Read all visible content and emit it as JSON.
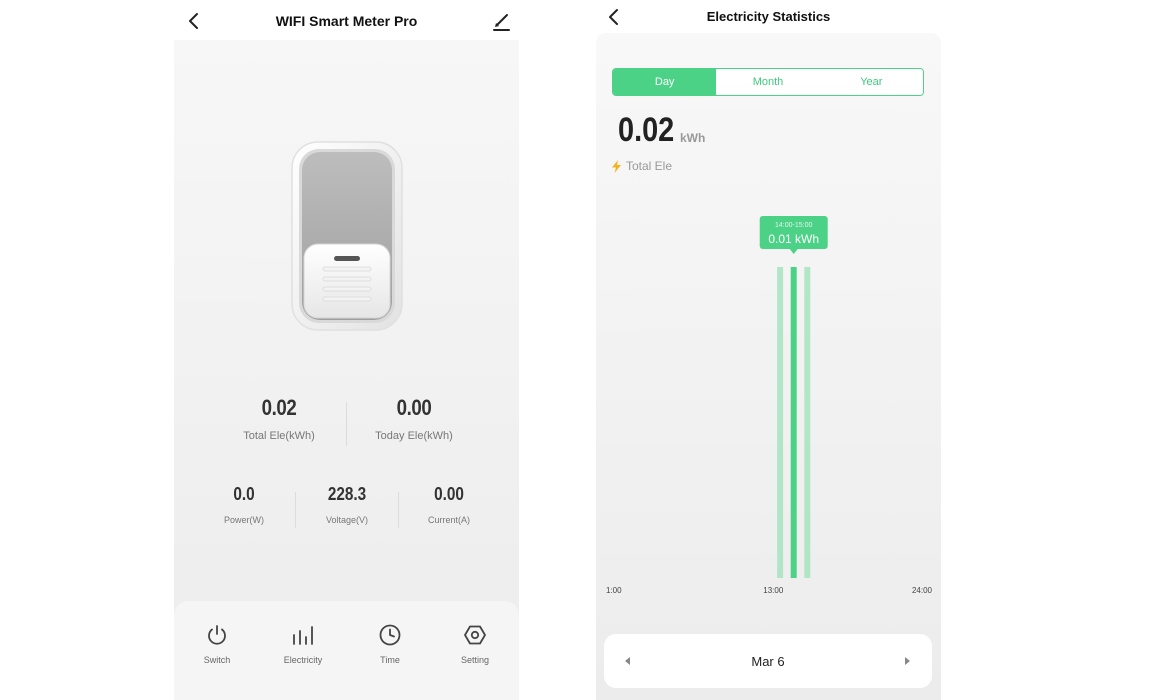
{
  "left": {
    "title": "WIFI Smart Meter Pro",
    "icons": {
      "back": "chevron-left-icon",
      "edit": "edit-pencil-icon",
      "device": "switch-device-icon"
    },
    "stats_main": [
      {
        "value": "0.02",
        "label": "Total Ele(kWh)"
      },
      {
        "value": "0.00",
        "label": "Today Ele(kWh)"
      }
    ],
    "stats_secondary": [
      {
        "value": "0.0",
        "label": "Power(W)"
      },
      {
        "value": "228.3",
        "label": "Voltage(V)"
      },
      {
        "value": "0.00",
        "label": "Current(A)"
      }
    ],
    "tabs": [
      {
        "label": "Switch",
        "icon": "power-icon"
      },
      {
        "label": "Electricity",
        "icon": "bar-chart-icon"
      },
      {
        "label": "Time",
        "icon": "clock-icon"
      },
      {
        "label": "Setting",
        "icon": "hexagon-settings-icon"
      }
    ]
  },
  "right": {
    "title": "Electricity Statistics",
    "icons": {
      "back": "chevron-left-icon",
      "bolt": "lightning-bolt-icon",
      "prev": "triangle-left-icon",
      "next": "triangle-right-icon"
    },
    "segments": [
      {
        "label": "Day",
        "active": true
      },
      {
        "label": "Month",
        "active": false
      },
      {
        "label": "Year",
        "active": false
      }
    ],
    "total": {
      "value": "0.02",
      "unit": "kWh",
      "label": "Total Ele"
    },
    "date": "Mar 6",
    "colors": {
      "accent": "#4cd287",
      "accent_light": "#9be3b8",
      "text": "#222222",
      "muted": "#999999"
    }
  },
  "chart_data": {
    "type": "bar",
    "x_ticks": [
      "1:00",
      "13:00",
      "24:00"
    ],
    "categories": [
      "13:00-14:00",
      "14:00-15:00",
      "15:00-16:00"
    ],
    "values": [
      0.01,
      0.01,
      0.01
    ],
    "highlighted": {
      "category": "14:00-15:00",
      "range_label": "14:00-15:00",
      "value_label": "0.01 kWh"
    },
    "grid": false,
    "legend": "none"
  }
}
